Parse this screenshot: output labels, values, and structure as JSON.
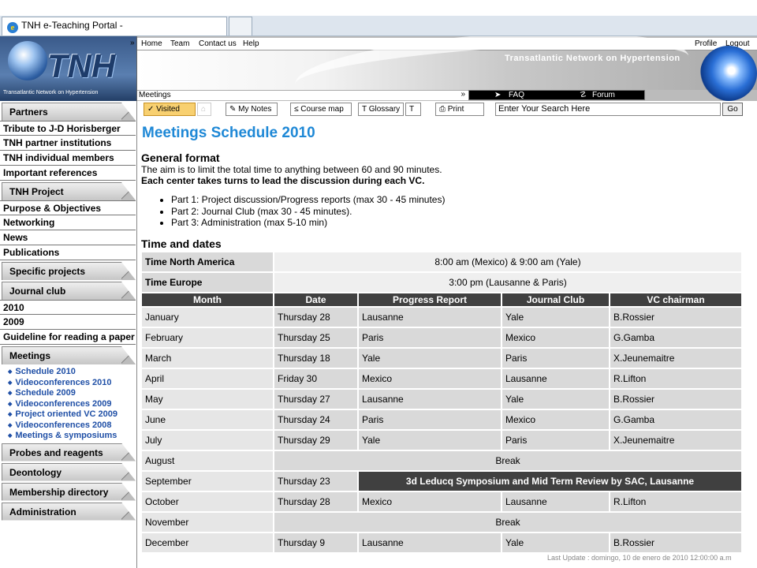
{
  "browser": {
    "tab_title": "TNH e-Teaching Portal -"
  },
  "header": {
    "logo_text": "TNH",
    "logo_tagline": "Transatlantic Network on Hypertension",
    "nav": [
      "Home",
      "Team",
      "Contact us",
      "Help"
    ],
    "profile": "Profile",
    "logout": "Logout",
    "banner_title": "Transatlantic Network on Hypertension",
    "breadcrumb": "Meetings",
    "faq": "FAQ",
    "forum": "Forum"
  },
  "sidebar": {
    "sections": [
      {
        "label": "Partners",
        "items": [
          "Tribute to J-D Horisberger",
          "TNH partner institutions",
          "TNH individual members",
          "Important references"
        ]
      },
      {
        "label": "TNH Project",
        "items": [
          "Purpose & Objectives",
          "Networking",
          "News",
          "Publications"
        ]
      },
      {
        "label": "Specific projects",
        "items": []
      },
      {
        "label": "Journal club",
        "items": [
          "2010",
          "2009",
          "Guideline for reading a paper"
        ]
      },
      {
        "label": "Meetings",
        "items": []
      }
    ],
    "meetings_subitems": [
      "Schedule 2010",
      "Videoconferences 2010",
      "Schedule 2009",
      "Videoconferences 2009",
      "Project oriented VC 2009",
      "Videoconferences 2008",
      "Meetings & symposiums"
    ],
    "bottom_sections": [
      "Probes and reagents",
      "Deontology",
      "Membership directory",
      "Administration"
    ]
  },
  "toolbar": {
    "visited": "✓ Visited",
    "my_notes": "My Notes",
    "course_map": "Course map",
    "glossary": "Glossary",
    "t": "T",
    "print": "Print",
    "search_placeholder": "Enter Your Search Here",
    "go": "Go"
  },
  "main": {
    "title": "Meetings Schedule 2010",
    "general_format_heading": "General format",
    "para1": "The aim is to limit the total time to anything between 60 and 90 minutes.",
    "para2": "Each center takes turns to lead the discussion during each VC.",
    "parts": [
      "Part 1: Project discussion/Progress reports (max 30 - 45 minutes)",
      "Part 2: Journal Club (max 30 - 45 minutes).",
      "Part 3: Administration (max 5-10 min)"
    ],
    "time_heading": "Time and dates",
    "time_rows": [
      {
        "label": "Time North America",
        "value": "8:00 am (Mexico) & 9:00 am (Yale)"
      },
      {
        "label": "Time Europe",
        "value": "3:00 pm (Lausanne & Paris)"
      }
    ],
    "columns": [
      "Month",
      "Date",
      "Progress Report",
      "Journal Club",
      "VC chairman"
    ],
    "rows": [
      {
        "month": "January",
        "date": "Thursday 28",
        "progress": "Lausanne",
        "journal": "Yale",
        "chair": "B.Rossier"
      },
      {
        "month": "February",
        "date": "Thursday 25",
        "progress": "Paris",
        "journal": "Mexico",
        "chair": "G.Gamba"
      },
      {
        "month": "March",
        "date": "Thursday 18",
        "progress": "Yale",
        "journal": "Paris",
        "chair": "X.Jeunemaitre"
      },
      {
        "month": "April",
        "date": "Friday 30",
        "progress": "Mexico",
        "journal": "Lausanne",
        "chair": "R.Lifton"
      },
      {
        "month": "May",
        "date": "Thursday 27",
        "progress": "Lausanne",
        "journal": "Yale",
        "chair": "B.Rossier"
      },
      {
        "month": "June",
        "date": "Thursday 24",
        "progress": "Paris",
        "journal": "Mexico",
        "chair": "G.Gamba"
      },
      {
        "month": "July",
        "date": "Thursday 29",
        "progress": "Yale",
        "journal": "Paris",
        "chair": "X.Jeunemaitre"
      },
      {
        "month": "August",
        "span": "Break"
      },
      {
        "month": "September",
        "date": "Thursday 23",
        "dark": "3d Leducq Symposium and Mid Term Review by SAC, Lausanne"
      },
      {
        "month": "October",
        "date": "Thursday 28",
        "progress": "Mexico",
        "journal": "Lausanne",
        "chair": "R.Lifton"
      },
      {
        "month": "November",
        "span": "Break"
      },
      {
        "month": "December",
        "date": "Thursday 9",
        "progress": "Lausanne",
        "journal": "Yale",
        "chair": "B.Rossier"
      }
    ],
    "footer": "Last Update : domingo, 10 de enero de 2010 12:00:00 a.m"
  }
}
